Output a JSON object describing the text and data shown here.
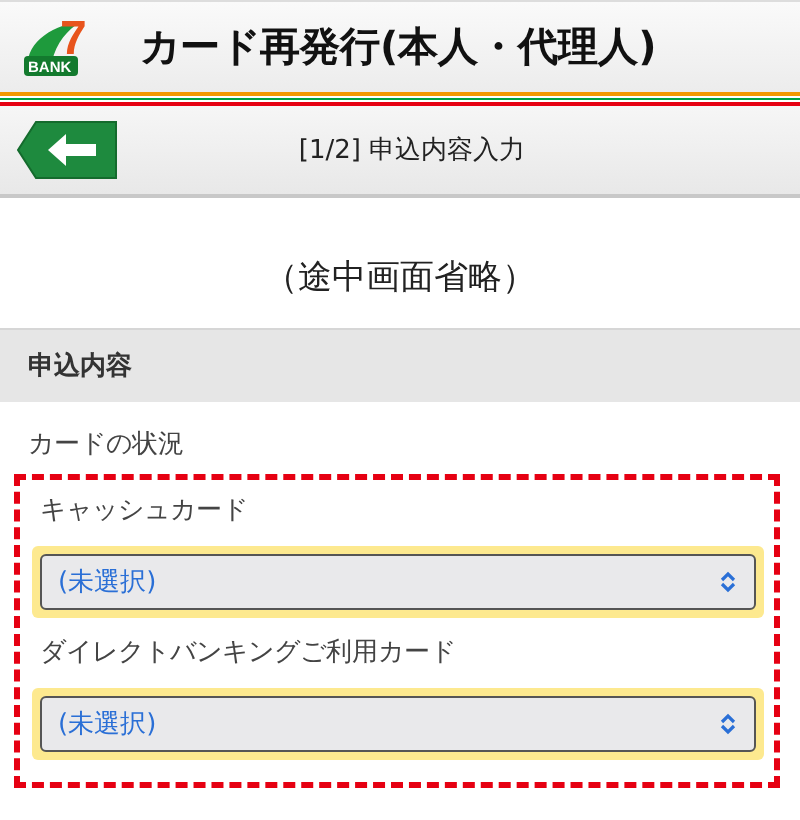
{
  "header": {
    "logo": {
      "mark": "7",
      "word": "BANK"
    },
    "title": "カード再発行(本人・代理人)"
  },
  "nav": {
    "back_button": {
      "kind": "back"
    },
    "step": "[1/2] 申込内容入力"
  },
  "omission_note": "（途中画面省略）",
  "section": {
    "title": "申込内容",
    "label": "カードの状況",
    "fields": [
      {
        "label": "キャッシュカード",
        "value": "(未選択)",
        "highlighted": true
      },
      {
        "label": "ダイレクトバンキングご利用カード",
        "value": "(未選択)",
        "highlighted": true
      }
    ]
  }
}
